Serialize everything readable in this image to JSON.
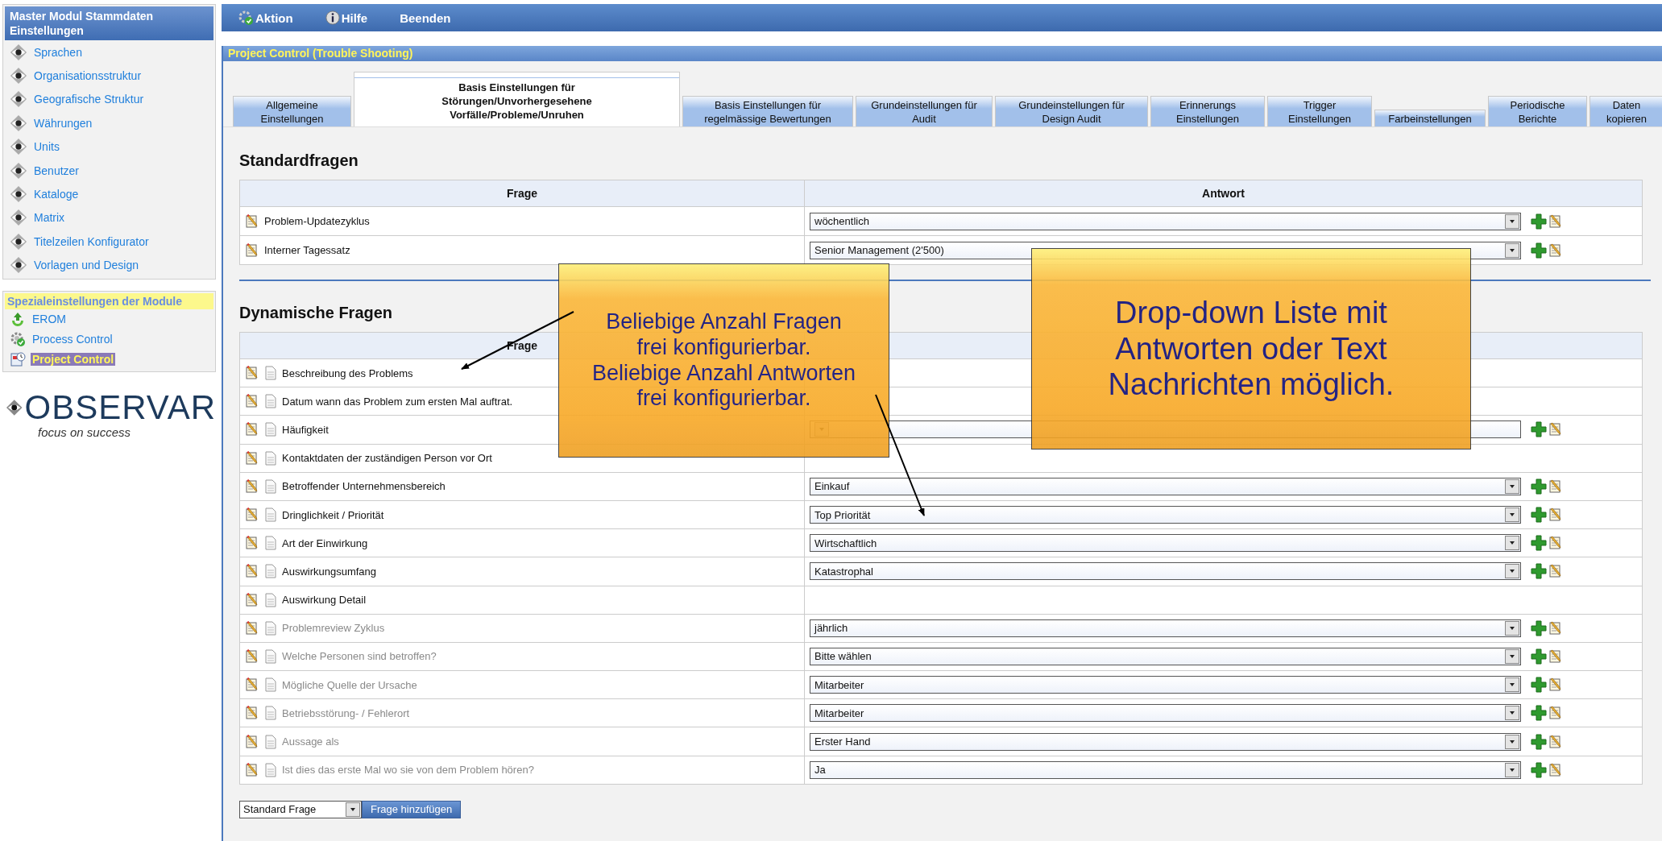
{
  "sidebar": {
    "title": "Master Modul Stammdaten Einstellungen",
    "items": [
      {
        "label": "Sprachen"
      },
      {
        "label": "Organisationsstruktur"
      },
      {
        "label": "Geografische Struktur"
      },
      {
        "label": "Währungen"
      },
      {
        "label": "Units"
      },
      {
        "label": "Benutzer"
      },
      {
        "label": "Kataloge"
      },
      {
        "label": "Matrix"
      },
      {
        "label": "Titelzeilen Konfigurator"
      },
      {
        "label": "Vorlagen und Design"
      }
    ]
  },
  "modules": {
    "title": "Spezialeinstellungen der Module",
    "items": [
      {
        "label": "EROM",
        "selected": false
      },
      {
        "label": "Process Control",
        "selected": false
      },
      {
        "label": "Project Control",
        "selected": true
      }
    ]
  },
  "logo": {
    "name": "OBSERVAR",
    "tagline": "focus on success"
  },
  "menu": [
    {
      "label": "Aktion"
    },
    {
      "label": "Hilfe"
    },
    {
      "label": "Beenden"
    }
  ],
  "panel_title": "Project Control (Trouble Shooting)",
  "tabs": [
    {
      "label": "Allgemeine\nEinstellungen",
      "selected": false
    },
    {
      "label": "Basis Einstellungen für\nStörungen/Unvorhergesehene\nVorfälle/Probleme/Unruhen",
      "selected": true
    },
    {
      "label": "Basis Einstellungen für\nregelmässige Bewertungen",
      "selected": false
    },
    {
      "label": "Grundeinstellungen für\nAudit",
      "selected": false
    },
    {
      "label": "Grundeinstellungen für\nDesign Audit",
      "selected": false
    },
    {
      "label": "Erinnerungs\nEinstellungen",
      "selected": false
    },
    {
      "label": "Trigger\nEinstellungen",
      "selected": false
    },
    {
      "label": "Farbeinstellungen",
      "selected": false
    },
    {
      "label": "Periodische\nBerichte",
      "selected": false
    },
    {
      "label": "Daten\nkopieren",
      "selected": false
    }
  ],
  "standard": {
    "title": "Standardfragen",
    "columns": [
      "Frage",
      "Antwort"
    ],
    "rows": [
      {
        "question": "Problem-Updatezyklus",
        "answer": "wöchentlich"
      },
      {
        "question": "Interner Tagessatz",
        "answer": "Senior Management (2'500)"
      }
    ]
  },
  "dynamic": {
    "title": "Dynamische Fragen",
    "columns": [
      "Frage"
    ],
    "rows": [
      {
        "question": "Beschreibung des Problems",
        "dropdown": false,
        "disabled": false
      },
      {
        "question": "Datum wann das Problem zum ersten Mal auftrat.",
        "dropdown": false,
        "disabled": false
      },
      {
        "question": "Häufigkeit",
        "dropdown": true,
        "disabled": false
      },
      {
        "question": "Kontaktdaten der zuständigen Person vor Ort",
        "dropdown": false,
        "disabled": false
      },
      {
        "question": "Betroffender Unternehmensbereich",
        "dropdown": true,
        "answer": "Einkauf",
        "disabled": false
      },
      {
        "question": "Dringlichkeit / Priorität",
        "dropdown": true,
        "answer": "Top Priorität",
        "disabled": false
      },
      {
        "question": "Art der Einwirkung",
        "dropdown": true,
        "answer": "Wirtschaftlich",
        "disabled": false
      },
      {
        "question": "Auswirkungsumfang",
        "dropdown": true,
        "answer": "Katastrophal",
        "disabled": false
      },
      {
        "question": "Auswirkung Detail",
        "dropdown": false,
        "disabled": false
      },
      {
        "question": "Problemreview Zyklus",
        "dropdown": true,
        "answer": "jährlich",
        "disabled": true
      },
      {
        "question": "Welche Personen sind betroffen?",
        "dropdown": true,
        "answer": "Bitte wählen",
        "disabled": true
      },
      {
        "question": "Mögliche Quelle der Ursache",
        "dropdown": true,
        "answer": "Mitarbeiter",
        "disabled": true
      },
      {
        "question": "Betriebsstörung- / Fehlerort",
        "dropdown": true,
        "answer": "Mitarbeiter",
        "disabled": true
      },
      {
        "question": "Aussage als",
        "dropdown": true,
        "answer": "Erster Hand",
        "disabled": true
      },
      {
        "question": "Ist dies das erste Mal wo sie von dem Problem hören?",
        "dropdown": true,
        "answer": "Ja",
        "disabled": true
      }
    ]
  },
  "footer": {
    "type_select": "Standard Frage",
    "add_button": "Frage hinzufügen"
  },
  "callouts": [
    {
      "text": "Beliebige Anzahl Fragen\nfrei konfigurierbar.\nBeliebige Anzahl Antworten\nfrei konfigurierbar."
    },
    {
      "text": "Drop-down Liste mit\nAntworten oder Text\nNachrichten möglich."
    }
  ]
}
